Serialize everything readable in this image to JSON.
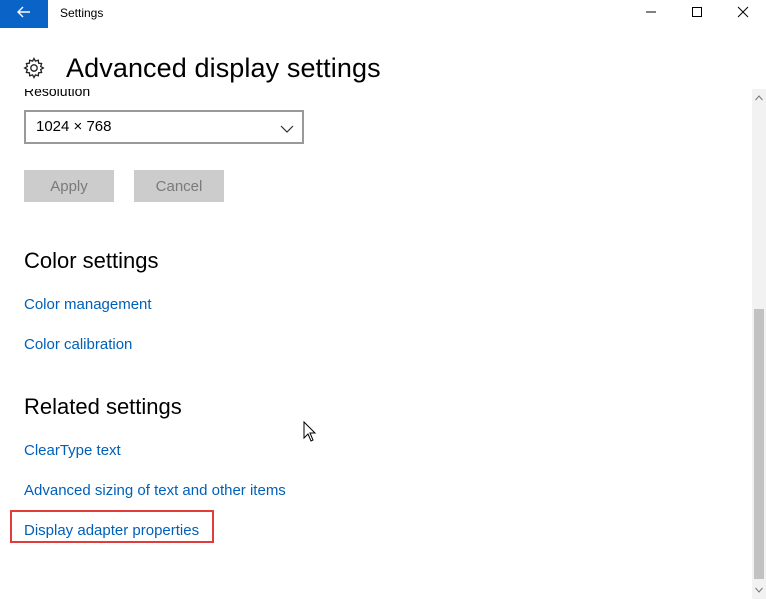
{
  "window": {
    "title": "Settings",
    "controls": [
      "minimize-icon",
      "maximize-icon",
      "close-icon"
    ]
  },
  "header": {
    "icon": "gear-icon",
    "title": "Advanced display settings"
  },
  "resolution": {
    "label": "Resolution",
    "value": "1024 × 768",
    "icon": "chevron-down-icon"
  },
  "buttons": {
    "apply_label": "Apply",
    "cancel_label": "Cancel"
  },
  "color_settings": {
    "heading": "Color settings",
    "links": [
      "Color management",
      "Color calibration"
    ]
  },
  "related_settings": {
    "heading": "Related settings",
    "links": [
      "ClearType text",
      "Advanced sizing of text and other items",
      "Display adapter properties"
    ]
  },
  "colors": {
    "accent": "#0a64c8",
    "link": "#0060b8",
    "highlight": "#e23b3b",
    "button_bg": "#cccccc"
  }
}
